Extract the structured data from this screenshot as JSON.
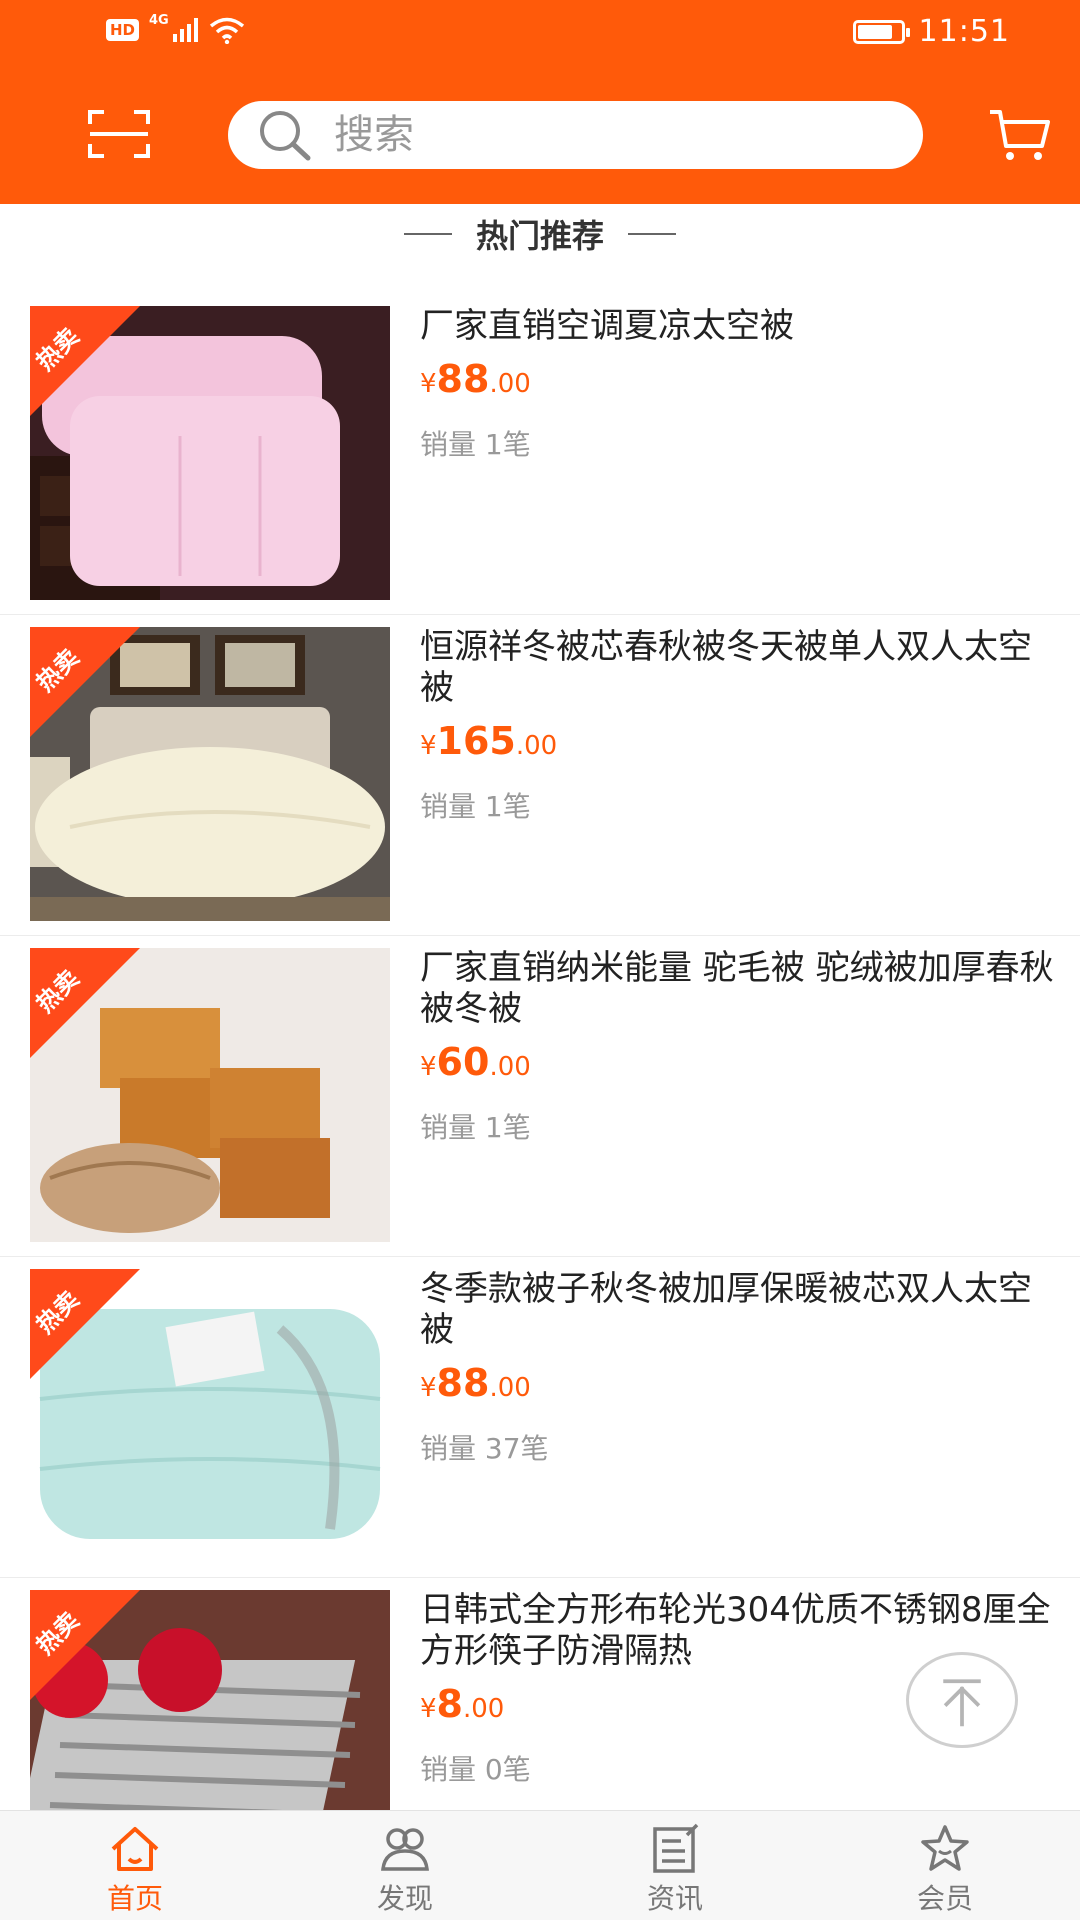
{
  "status_bar": {
    "hd": "HD",
    "network": "4G",
    "time": "11:51",
    "battery_level": 0.8
  },
  "header": {
    "search_placeholder": "搜索"
  },
  "section": {
    "title": "热门推荐"
  },
  "products": [
    {
      "tag": "热卖",
      "title": "厂家直销空调夏凉太空被",
      "currency": "¥",
      "price_int": "88",
      "price_dec": ".00",
      "sales": "销量 1笔",
      "image": "pink-quilt"
    },
    {
      "tag": "热卖",
      "title": "恒源祥冬被芯春秋被冬天被单人双人太空被",
      "currency": "¥",
      "price_int": "165",
      "price_dec": ".00",
      "sales": "销量 1笔",
      "image": "bedroom-quilt"
    },
    {
      "tag": "热卖",
      "title": "厂家直销纳米能量  驼毛被  驼绒被加厚春秋被冬被",
      "currency": "¥",
      "price_int": "60",
      "price_dec": ".00",
      "sales": "销量 1笔",
      "image": "gift-boxes"
    },
    {
      "tag": "热卖",
      "title": "冬季款被子秋冬被加厚保暖被芯双人太空被",
      "currency": "¥",
      "price_int": "88",
      "price_dec": ".00",
      "sales": "销量 37笔",
      "image": "blue-quilt"
    },
    {
      "tag": "热卖",
      "title": "日韩式全方形布轮光304优质不锈钢8厘全方形筷子防滑隔热",
      "currency": "¥",
      "price_int": "8",
      "price_dec": ".00",
      "sales": "销量 0笔",
      "image": "chopsticks"
    }
  ],
  "bottom_nav": [
    {
      "label": "首页",
      "icon": "home-icon",
      "active": true
    },
    {
      "label": "发现",
      "icon": "discover-icon",
      "active": false
    },
    {
      "label": "资讯",
      "icon": "news-icon",
      "active": false
    },
    {
      "label": "会员",
      "icon": "member-icon",
      "active": false
    }
  ],
  "colors": {
    "brand": "#ff5a0a",
    "hot_tag": "#ff4a1a",
    "muted": "#999999"
  }
}
